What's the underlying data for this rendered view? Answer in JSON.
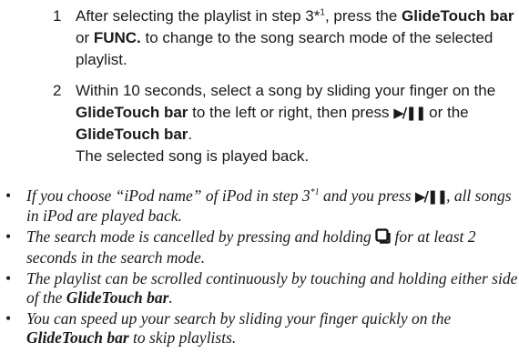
{
  "steps": [
    {
      "number": "1",
      "parts": {
        "t1": "After selecting the playlist in step 3*",
        "sup": "1",
        "t2": ", press the ",
        "b1": "GlideTouch bar",
        "t3": "or ",
        "b2": "FUNC.",
        "t4": " to change to the song search mode of the selected playlist."
      }
    },
    {
      "number": "2",
      "parts": {
        "t1": "Within 10 seconds, select a song by sliding your finger on the ",
        "b1": "GlideTouch bar",
        "t2": " to the left or right, then press ",
        "t3": " or the ",
        "b2": "GlideTouch bar",
        "t4": ".",
        "result": "The selected song is played back."
      }
    }
  ],
  "notes": {
    "bullet": "•",
    "n1": {
      "t1": "If you choose “iPod name” of iPod in step 3",
      "sup": "*1",
      "t2": " and you press ",
      "t3": ", all songs in iPod are played back."
    },
    "n2": {
      "t1": "The search mode is cancelled by pressing and holding ",
      "t2": " for at least 2 seconds in the search mode."
    },
    "n3": {
      "t1": "The playlist can be scrolled continuously by touching and holding either side of the ",
      "b1": "GlideTouch bar",
      "t2": "."
    },
    "n4": {
      "t1": "You can speed up your search by sliding your finger quickly on the ",
      "b1": "GlideTouch bar",
      "t2": " to skip playlists."
    }
  },
  "icons": {
    "play_pause": "play-pause-icon",
    "home": "home-button-icon"
  }
}
